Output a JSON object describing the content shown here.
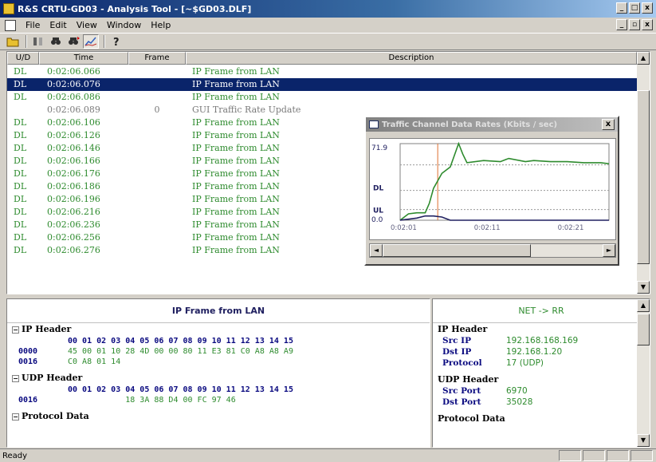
{
  "window": {
    "title": "R&S CRTU-GD03 - Analysis Tool - [~$GD03.DLF]",
    "controls": [
      "_",
      "□",
      "x"
    ],
    "mdi_controls": [
      "_",
      " ",
      "x"
    ]
  },
  "menu": [
    "File",
    "Edit",
    "View",
    "Window",
    "Help"
  ],
  "toolbar": {
    "buttons": [
      "open-icon",
      "filter-icon",
      "find-icon",
      "find-next-icon",
      "chart-icon",
      "help-icon"
    ]
  },
  "list": {
    "columns": [
      "U/D",
      "Time",
      "Frame",
      "Description"
    ],
    "rows": [
      {
        "ud": "DL",
        "time": "0:02:06.066",
        "frame": "",
        "desc": "IP Frame from LAN"
      },
      {
        "ud": "DL",
        "time": "0:02:06.076",
        "frame": "",
        "desc": "IP Frame from LAN"
      },
      {
        "ud": "DL",
        "time": "0:02:06.086",
        "frame": "",
        "desc": "IP Frame from LAN"
      },
      {
        "ud": "",
        "time": "0:02:06.089",
        "frame": "0",
        "desc": "GUI Traffic Rate Update"
      },
      {
        "ud": "DL",
        "time": "0:02:06.106",
        "frame": "",
        "desc": "IP Frame from LAN"
      },
      {
        "ud": "DL",
        "time": "0:02:06.126",
        "frame": "",
        "desc": "IP Frame from LAN"
      },
      {
        "ud": "DL",
        "time": "0:02:06.146",
        "frame": "",
        "desc": "IP Frame from LAN"
      },
      {
        "ud": "DL",
        "time": "0:02:06.166",
        "frame": "",
        "desc": "IP Frame from LAN"
      },
      {
        "ud": "DL",
        "time": "0:02:06.176",
        "frame": "",
        "desc": "IP Frame from LAN"
      },
      {
        "ud": "DL",
        "time": "0:02:06.186",
        "frame": "",
        "desc": "IP Frame from LAN"
      },
      {
        "ud": "DL",
        "time": "0:02:06.196",
        "frame": "",
        "desc": "IP Frame from LAN"
      },
      {
        "ud": "DL",
        "time": "0:02:06.216",
        "frame": "",
        "desc": "IP Frame from LAN"
      },
      {
        "ud": "DL",
        "time": "0:02:06.236",
        "frame": "",
        "desc": "IP Frame from LAN"
      },
      {
        "ud": "DL",
        "time": "0:02:06.256",
        "frame": "",
        "desc": "IP Frame from LAN"
      },
      {
        "ud": "DL",
        "time": "0:02:06.276",
        "frame": "",
        "desc": "IP Frame from LAN"
      }
    ],
    "selected_index": 1
  },
  "popup": {
    "title": "Traffic Channel Data Rates (Kbits / sec)",
    "close": "x",
    "chart_data": {
      "type": "line",
      "ymax_label": "71.9",
      "ymin_label": "0.0",
      "series_labels": [
        "DL",
        "UL"
      ],
      "x_ticks": [
        "0:02:01",
        "0:02:11",
        "0:02:21"
      ],
      "cursor_x": 4.5,
      "x_range": [
        0,
        25
      ],
      "y_range": [
        0,
        71.9
      ],
      "series": [
        {
          "name": "DL",
          "color": "#2e8b2e",
          "points": [
            [
              0,
              0
            ],
            [
              1,
              6
            ],
            [
              2,
              7
            ],
            [
              3,
              7
            ],
            [
              3.5,
              16
            ],
            [
              4,
              30
            ],
            [
              5,
              44
            ],
            [
              6,
              50
            ],
            [
              7,
              72
            ],
            [
              7.5,
              62
            ],
            [
              8,
              54
            ],
            [
              10,
              56
            ],
            [
              12,
              55
            ],
            [
              13,
              58
            ],
            [
              15,
              55
            ],
            [
              16,
              56
            ],
            [
              18,
              55
            ],
            [
              20,
              55
            ],
            [
              22,
              54
            ],
            [
              24,
              54
            ],
            [
              25,
              53
            ]
          ]
        },
        {
          "name": "UL",
          "color": "#202060",
          "points": [
            [
              0,
              0
            ],
            [
              1,
              1
            ],
            [
              2,
              2
            ],
            [
              3,
              4
            ],
            [
              4,
              4
            ],
            [
              5,
              3
            ],
            [
              6,
              0
            ],
            [
              25,
              0
            ]
          ]
        }
      ],
      "dashed_lines": [
        52,
        28,
        10
      ]
    }
  },
  "lower_left": {
    "title": "IP Frame from LAN",
    "sections": [
      {
        "name": "IP Header",
        "toggle": "⊟",
        "cols": "00 01 02 03 04 05 06 07 08 09 10 11 12 13 14 15",
        "lines": [
          {
            "off": "0000",
            "data": "45 00 01 10 28 4D 00 00 80 11 E3 81 C0 A8 A8 A9"
          },
          {
            "off": "0016",
            "data": "C0 A8 01 14"
          }
        ]
      },
      {
        "name": "UDP Header",
        "toggle": "⊟",
        "cols": "00 01 02 03 04 05 06 07 08 09 10 11 12 13 14 15",
        "lines": [
          {
            "off": "0016",
            "data": "            18 3A 88 D4 00 FC 97 46"
          }
        ]
      },
      {
        "name": "Protocol Data",
        "toggle": "⊟",
        "cols": "",
        "lines": []
      }
    ]
  },
  "lower_right": {
    "title": "NET   ->   RR",
    "sections": [
      {
        "name": "IP Header",
        "items": [
          {
            "k": "Src IP",
            "v": "192.168.168.169"
          },
          {
            "k": "Dst IP",
            "v": "192.168.1.20"
          },
          {
            "k": "Protocol",
            "v": "17 (UDP)"
          }
        ]
      },
      {
        "name": "UDP Header",
        "items": [
          {
            "k": "Src Port",
            "v": "6970"
          },
          {
            "k": "Dst Port",
            "v": "35028"
          }
        ]
      },
      {
        "name": "Protocol Data",
        "items": []
      }
    ]
  },
  "status": {
    "text": "Ready"
  }
}
